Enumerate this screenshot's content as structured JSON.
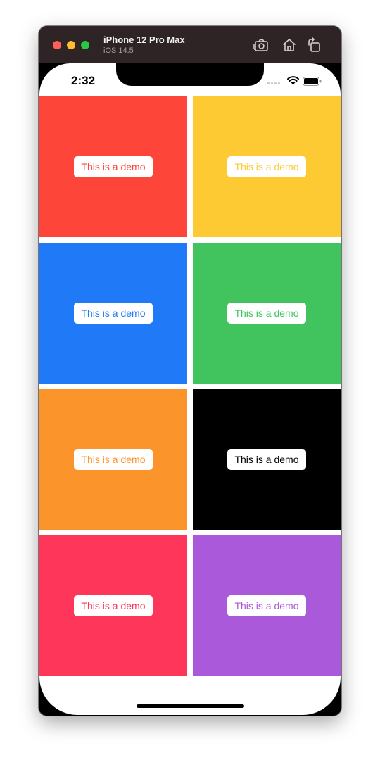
{
  "window": {
    "device_name": "iPhone 12 Pro Max",
    "os_version": "iOS 14.5",
    "traffic_lights": {
      "close": "#fe5f57",
      "minimize": "#febc2e",
      "maximize": "#28c840"
    },
    "toolbar_icons": [
      "screenshot-icon",
      "home-icon",
      "rotate-icon"
    ]
  },
  "status_bar": {
    "time": "2:32",
    "icons": [
      "cellular-signal-icon",
      "wifi-icon",
      "battery-icon"
    ]
  },
  "tiles": [
    {
      "label": "This is a demo",
      "background": "#fe453a",
      "text_color": "#fe453a"
    },
    {
      "label": "This is a demo",
      "background": "#fdca33",
      "text_color": "#fdca33"
    },
    {
      "label": "This is a demo",
      "background": "#2079f6",
      "text_color": "#2079f6"
    },
    {
      "label": "This is a demo",
      "background": "#41c45d",
      "text_color": "#41c45d"
    },
    {
      "label": "This is a demo",
      "background": "#fb952b",
      "text_color": "#fb952b"
    },
    {
      "label": "This is a demo",
      "background": "#000000",
      "text_color": "#000000"
    },
    {
      "label": "This is a demo",
      "background": "#fe365a",
      "text_color": "#fe365a"
    },
    {
      "label": "This is a demo",
      "background": "#ab59db",
      "text_color": "#ab59db"
    }
  ]
}
